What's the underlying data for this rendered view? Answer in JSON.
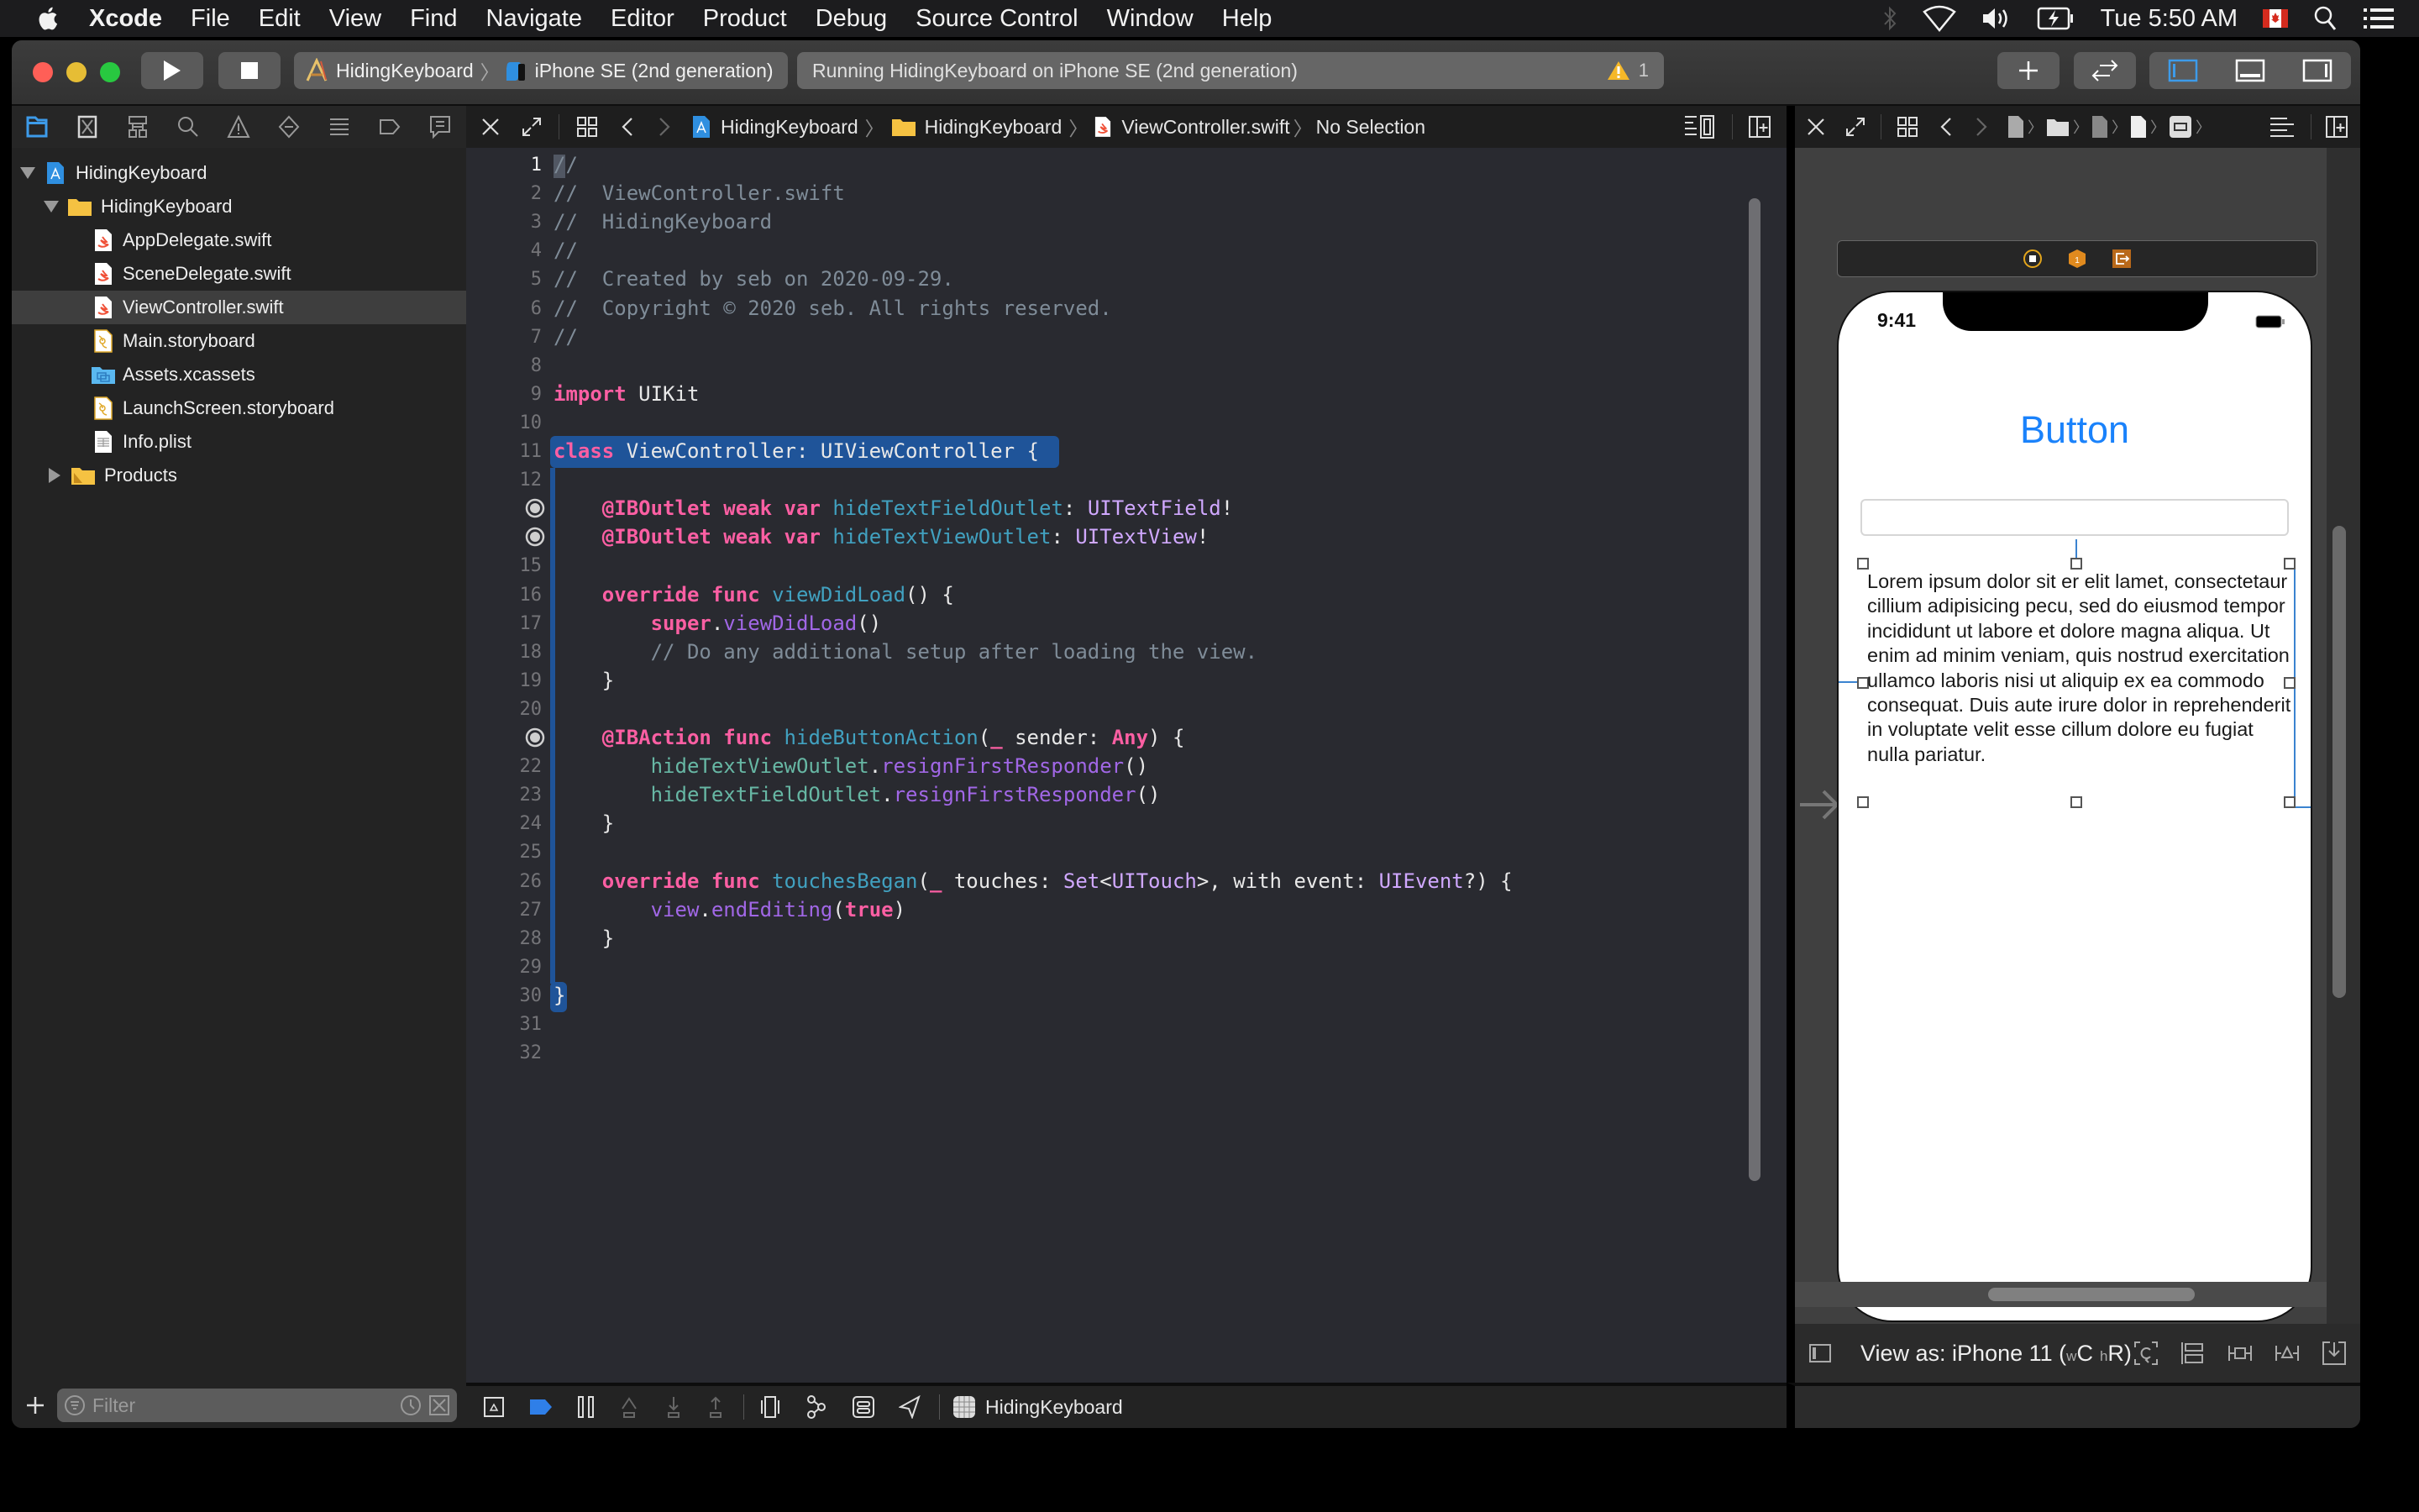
{
  "menubar": {
    "apple_icon": "apple-logo-icon",
    "items": [
      "Xcode",
      "File",
      "Edit",
      "View",
      "Find",
      "Navigate",
      "Editor",
      "Product",
      "Debug",
      "Source Control",
      "Window",
      "Help"
    ],
    "status": {
      "icons": [
        "bluetooth-icon",
        "wifi-icon",
        "volume-icon",
        "battery-charging-icon"
      ],
      "clock": "Tue 5:50 AM",
      "input_source": "canada-flag-icon",
      "extra_icons": [
        "spotlight-icon",
        "notification-center-icon"
      ]
    }
  },
  "toolbar": {
    "scheme": "HidingKeyboard",
    "device": "iPhone SE (2nd generation)",
    "activity": "Running HidingKeyboard on iPhone SE (2nd generation)",
    "warning_count": "1",
    "colors": {
      "close": "#ff5f57",
      "minimize": "#e6bd35",
      "zoom": "#28c840",
      "accent": "#3d9be9"
    }
  },
  "navigator": {
    "tabs": [
      "project-navigator",
      "source-control-navigator",
      "symbol-navigator",
      "find-navigator",
      "issue-navigator",
      "test-navigator",
      "debug-navigator",
      "breakpoint-navigator",
      "report-navigator"
    ],
    "tree": [
      {
        "label": "HidingKeyboard",
        "type": "project",
        "expanded": true,
        "depth": 0
      },
      {
        "label": "HidingKeyboard",
        "type": "folder",
        "expanded": true,
        "depth": 1
      },
      {
        "label": "AppDelegate.swift",
        "type": "swift",
        "depth": 2
      },
      {
        "label": "SceneDelegate.swift",
        "type": "swift",
        "depth": 2
      },
      {
        "label": "ViewController.swift",
        "type": "swift",
        "depth": 2,
        "selected": true
      },
      {
        "label": "Main.storyboard",
        "type": "storyboard",
        "depth": 2
      },
      {
        "label": "Assets.xcassets",
        "type": "assets",
        "depth": 2
      },
      {
        "label": "LaunchScreen.storyboard",
        "type": "storyboard",
        "depth": 2
      },
      {
        "label": "Info.plist",
        "type": "plist",
        "depth": 2
      },
      {
        "label": "Products",
        "type": "folder",
        "expanded": false,
        "depth": 1
      }
    ],
    "filter_placeholder": "Filter"
  },
  "editor": {
    "jumpbar": [
      "HidingKeyboard",
      "HidingKeyboard",
      "ViewController.swift",
      "No Selection"
    ],
    "current_line": "1",
    "lines": [
      {
        "n": "1",
        "html": "<span class='c'>//</span>"
      },
      {
        "n": "2",
        "html": "<span class='c'>//  ViewController.swift</span>"
      },
      {
        "n": "3",
        "html": "<span class='c'>//  HidingKeyboard</span>"
      },
      {
        "n": "4",
        "html": "<span class='c'>//</span>"
      },
      {
        "n": "5",
        "html": "<span class='c'>//  Created by seb on 2020-09-29.</span>"
      },
      {
        "n": "6",
        "html": "<span class='c'>//  Copyright © 2020 seb. All rights reserved.</span>"
      },
      {
        "n": "7",
        "html": "<span class='c'>//</span>"
      },
      {
        "n": "8",
        "html": ""
      },
      {
        "n": "9",
        "html": "<span class='k'>import</span> UIKit"
      },
      {
        "n": "10",
        "html": ""
      },
      {
        "n": "11",
        "html": "<span class='k'>class</span> ViewController: UIViewController {"
      },
      {
        "n": "12",
        "html": ""
      },
      {
        "n": "",
        "outlet": true,
        "html": "    <span class='k'>@IBOutlet</span> <span class='k'>weak</span> <span class='k'>var</span> <span class='d'>hideTextFieldOutlet</span>: <span class='t'>UITextField</span>!"
      },
      {
        "n": "",
        "outlet": true,
        "html": "    <span class='k'>@IBOutlet</span> <span class='k'>weak</span> <span class='k'>var</span> <span class='d'>hideTextViewOutlet</span>: <span class='t'>UITextView</span>!"
      },
      {
        "n": "15",
        "html": ""
      },
      {
        "n": "16",
        "html": "    <span class='k'>override</span> <span class='k'>func</span> <span class='d'>viewDidLoad</span>() {"
      },
      {
        "n": "17",
        "html": "        <span class='k'>super</span>.<span class='p'>viewDidLoad</span>()"
      },
      {
        "n": "18",
        "html": "        <span class='c'>// Do any additional setup after loading the view.</span>"
      },
      {
        "n": "19",
        "html": "    }"
      },
      {
        "n": "20",
        "html": ""
      },
      {
        "n": "",
        "outlet": true,
        "html": "    <span class='k'>@IBAction</span> <span class='k'>func</span> <span class='d'>hideButtonAction</span>(<span class='k'>_</span> sender: <span class='k'>Any</span>) {"
      },
      {
        "n": "22",
        "html": "        <span class='v'>hideTextViewOutlet</span>.<span class='p'>resignFirstResponder</span>()"
      },
      {
        "n": "23",
        "html": "        <span class='v'>hideTextFieldOutlet</span>.<span class='p'>resignFirstResponder</span>()"
      },
      {
        "n": "24",
        "html": "    }"
      },
      {
        "n": "25",
        "html": ""
      },
      {
        "n": "26",
        "html": "    <span class='k'>override</span> <span class='k'>func</span> <span class='d'>touchesBegan</span>(<span class='k'>_</span> touches: <span class='t'>Set</span>&lt;<span class='t'>UITouch</span>&gt;, with event: <span class='t'>UIEvent</span>?) {"
      },
      {
        "n": "27",
        "html": "        <span class='p'>view</span>.<span class='p'>endEditing</span>(<span class='k'>true</span>)"
      },
      {
        "n": "28",
        "html": "    }"
      },
      {
        "n": "29",
        "html": ""
      },
      {
        "n": "30",
        "html": "}"
      },
      {
        "n": "31",
        "html": ""
      },
      {
        "n": "32",
        "html": ""
      }
    ]
  },
  "debugbar": {
    "target": "HidingKeyboard"
  },
  "canvas": {
    "status_time": "9:41",
    "button_label": "Button",
    "textfield_value": "",
    "textview_text": "Lorem ipsum dolor sit er elit lamet, consectetaur cillium adipisicing pecu, sed do eiusmod tempor incididunt ut labore et dolore magna aliqua. Ut enim ad minim veniam, quis nostrud exercitation ullamco laboris nisi ut aliquip ex ea commodo consequat. Duis aute irure dolor in reprehenderit in voluptate velit esse cillum dolore eu fugiat nulla pariatur.",
    "view_as_prefix": "View as: iPhone 11 (",
    "size_w": "w",
    "size_w_class": "C",
    "size_h": "h",
    "size_h_class": "R",
    "view_as_suffix": ")",
    "button_color": "#1a82fb"
  }
}
